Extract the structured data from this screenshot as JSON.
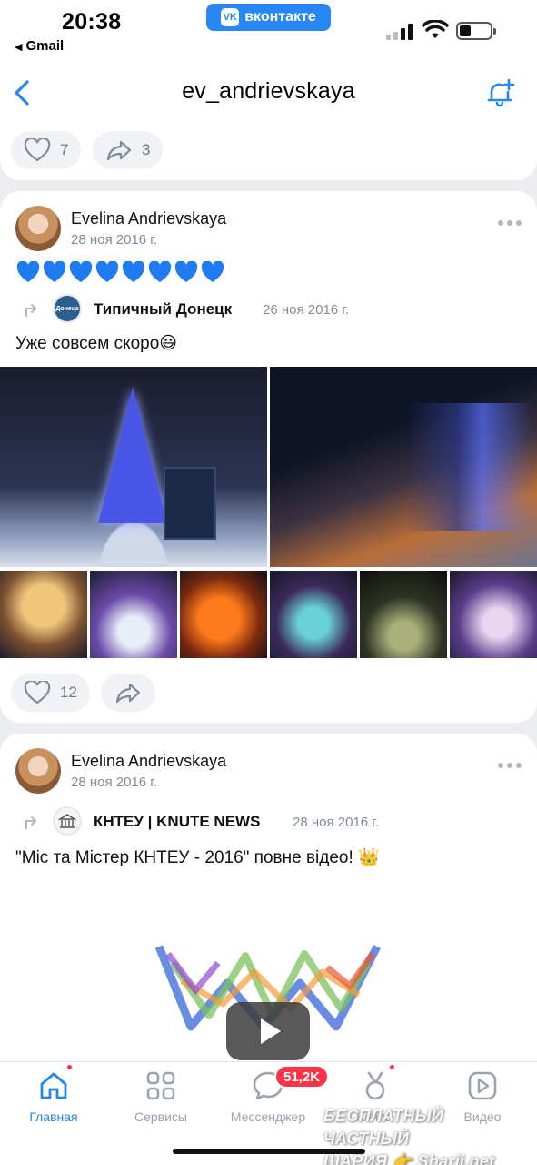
{
  "status_bar": {
    "time": "20:38",
    "back_app": "Gmail",
    "vk_label": "вконтакте",
    "vk_logo": "VK"
  },
  "header": {
    "title": "ev_andrievskaya"
  },
  "top_post": {
    "likes": "7",
    "reposts": "3"
  },
  "post1": {
    "author": "Evelina Andrievskaya",
    "date": "28 ноя 2016 г.",
    "hearts": [
      "💙",
      "💙",
      "💙",
      "💙",
      "💙",
      "💙",
      "💙",
      "💙"
    ],
    "repost": {
      "group": "Типичный Донецк",
      "group_avatar_text": "Донецк",
      "date": "26 ноя 2016 г.",
      "text": "Уже совсем скоро😃"
    },
    "likes": "12"
  },
  "post2": {
    "author": "Evelina Andrievskaya",
    "date": "28 ноя 2016 г.",
    "repost": {
      "group": "КНТЕУ | KNUTE NEWS",
      "date": "28 ноя 2016 г.",
      "text": "\"Міс та Містер КНТЕУ - 2016\" повне відео! 👑"
    }
  },
  "tabs": [
    {
      "label": "Главная",
      "icon": "home-icon",
      "active": true
    },
    {
      "label": "Сервисы",
      "icon": "services-icon"
    },
    {
      "label": "Мессенджер",
      "icon": "messenger-icon",
      "badge": "51,2K"
    },
    {
      "label": "Клипы",
      "icon": "clips-icon"
    },
    {
      "label": "Видео",
      "icon": "video-icon"
    }
  ],
  "watermark": {
    "line1": "БЕСПЛАТНЫЙ ЧАСТНЫЙ",
    "line2": "ШАРИЯ 👉 Sharij.net"
  },
  "colors": {
    "accent": "#2688eb",
    "badge": "#ff3347",
    "muted": "#818c99"
  }
}
